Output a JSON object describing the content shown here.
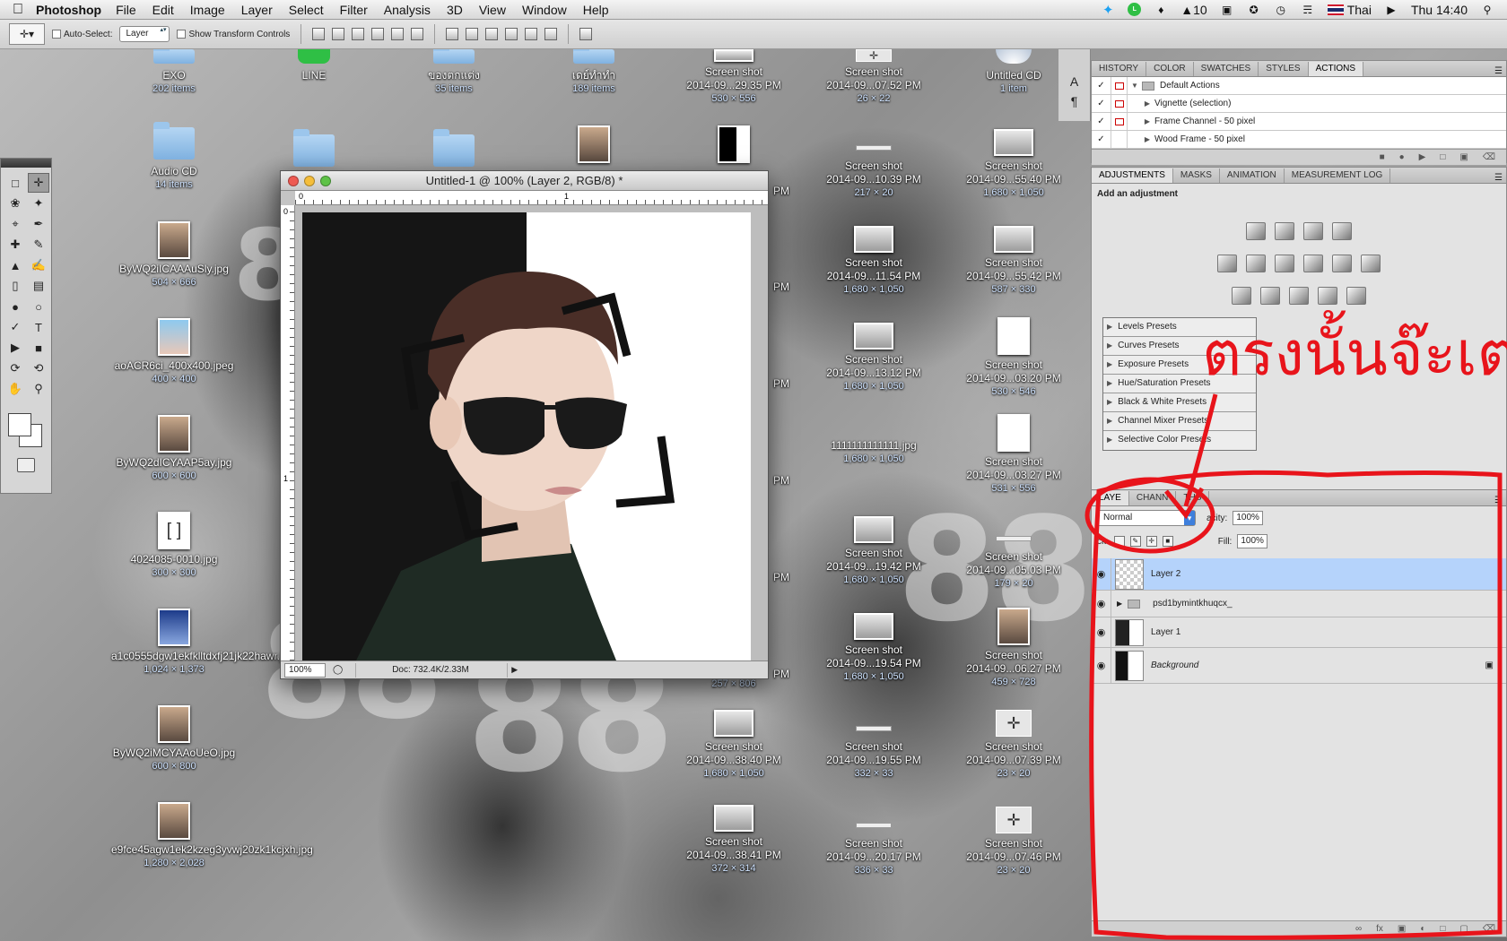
{
  "menubar": {
    "app_name": "Photoshop",
    "items": [
      "File",
      "Edit",
      "Image",
      "Layer",
      "Select",
      "Filter",
      "Analysis",
      "3D",
      "View",
      "Window",
      "Help"
    ],
    "right": {
      "badge": "10",
      "input_source": "Thai",
      "clock": "Thu 14:40"
    }
  },
  "options_bar": {
    "auto_select_label": "Auto-Select:",
    "auto_select_value": "Layer",
    "transform_label": "Show Transform Controls"
  },
  "desktop_icons": [
    {
      "name": "EXO",
      "sub": "202 items"
    },
    {
      "name": "LINE",
      "sub": ""
    },
    {
      "name": "ของตกแต่ง",
      "sub": "35 items"
    },
    {
      "name": "เดย์ทำทำ",
      "sub": "189 items"
    },
    {
      "name": "Screen shot",
      "sub2": "2014-09...29.35 PM",
      "sub": "530 × 556"
    },
    {
      "name": "Screen shot",
      "sub2": "2014-09...07.52 PM",
      "sub": "26 × 22"
    },
    {
      "name": "Untitled CD",
      "sub": "1 item"
    },
    {
      "name": "Audio CD",
      "sub": "14 items"
    },
    {
      "name": "ByWQ2iICAAAuSly.jpg",
      "sub": "504 × 666"
    },
    {
      "name": "aoACR6ci_400x400.jpeg",
      "sub": "400 × 400"
    },
    {
      "name": "ByWQ2dICYAAP5ay.jpg",
      "sub": "600 × 600"
    },
    {
      "name": "4024085-0010.jpg",
      "sub": "300 × 300"
    },
    {
      "name": "a1c0555dgw1ekfklltdxfj21jk22hawr.jpg",
      "sub": "1,024 × 1,373"
    },
    {
      "name": "ByWQ2iMCYAAoUeO.jpg",
      "sub": "600 × 800"
    },
    {
      "name": "e9fce45agw1ek2kzeg3yvwj20zk1kcjxh.jpg",
      "sub": "1,280 × 2,028"
    },
    {
      "name": "Screen shot",
      "sub2": "2014-09...10.39 PM",
      "sub": "217 × 20"
    },
    {
      "name": "Screen shot",
      "sub2": "2014-09...55.40 PM",
      "sub": "1,680 × 1,050"
    },
    {
      "name": "Screen shot",
      "sub2": "2014-09...11.54 PM",
      "sub": "1,680 × 1,050"
    },
    {
      "name": "Screen shot",
      "sub2": "2014-09...55.42 PM",
      "sub": "587 × 330"
    },
    {
      "name": "Screen shot",
      "sub2": "2014-09...13.12 PM",
      "sub": "1,680 × 1,050"
    },
    {
      "name": "Screen shot",
      "sub2": "2014-09...03.20 PM",
      "sub": "530 × 546"
    },
    {
      "name": "1111111111111.jpg",
      "sub": "1,680 × 1,050"
    },
    {
      "name": "Screen shot",
      "sub2": "2014-09...03.27 PM",
      "sub": "531 × 556"
    },
    {
      "name": "Screen shot",
      "sub2": "2014-09...19.42 PM",
      "sub": "1,680 × 1,050"
    },
    {
      "name": "Screen shot",
      "sub2": "2014-09...05.03 PM",
      "sub": "179 × 20"
    },
    {
      "name": "Screen shot",
      "sub2": "2014-09...19.54 PM",
      "sub": "1,680 × 1,050"
    },
    {
      "name": "Screen shot",
      "sub2": "2014-09...06.27 PM",
      "sub": "459 × 728"
    },
    {
      "name": "Screen shot",
      "sub2": "2014-09...38.40 PM",
      "sub": "1,680 × 1,050"
    },
    {
      "name": "Screen shot",
      "sub2": "2014-09...19.55 PM",
      "sub": "332 × 33"
    },
    {
      "name": "Screen shot",
      "sub2": "2014-09...07.39 PM",
      "sub": "23 × 20"
    },
    {
      "name": "Screen shot",
      "sub2": "2014-09...38.41 PM",
      "sub": "372 × 314"
    },
    {
      "name": "Screen shot",
      "sub2": "2014-09...20.17 PM",
      "sub": "336 × 33"
    },
    {
      "name": "Screen shot",
      "sub2": "2014-09...07.46 PM",
      "sub": "23 × 20"
    },
    {
      "name": "",
      "sub": "257 × 806"
    }
  ],
  "partial_labels": [
    "PM",
    "PM",
    "PM",
    "PM",
    "PM",
    "PM",
    "PM"
  ],
  "document": {
    "title": "Untitled-1 @ 100% (Layer 2, RGB/8) *",
    "ruler_h": [
      "0",
      "1"
    ],
    "ruler_v": [
      "0",
      "1"
    ],
    "zoom": "100%",
    "doc_info": "Doc: 732.4K/2.33M"
  },
  "actions_panel": {
    "tabs": [
      "HISTORY",
      "COLOR",
      "SWATCHES",
      "STYLES",
      "ACTIONS"
    ],
    "active_tab": "ACTIONS",
    "rows": [
      "Default Actions",
      "Vignette (selection)",
      "Frame Channel - 50 pixel",
      "Wood Frame - 50 pixel"
    ]
  },
  "adjustments_panel": {
    "tabs": [
      "ADJUSTMENTS",
      "MASKS",
      "ANIMATION",
      "MEASUREMENT LOG"
    ],
    "active_tab": "ADJUSTMENTS",
    "heading": "Add an adjustment",
    "presets": [
      "Levels Presets",
      "Curves Presets",
      "Exposure Presets",
      "Hue/Saturation Presets",
      "Black & White Presets",
      "Channel Mixer Presets",
      "Selective Color Presets"
    ]
  },
  "layers_panel": {
    "tabs": [
      "LAYERS",
      "CHANNELS",
      "PATHS"
    ],
    "tab_visible": [
      "LAYE",
      "CHANN",
      "THS"
    ],
    "blend_mode": "Normal",
    "opacity_label": "Opacity:",
    "opacity_label_visible": "acity:",
    "opacity": "100%",
    "lock_label": "Lock:",
    "lock_label_visible": "ck:",
    "fill_label": "Fill:",
    "fill": "100%",
    "layers": [
      "Layer 2",
      "psd1bymintkhuqcx_",
      "Layer 1",
      "Background"
    ],
    "selected_layer": "Layer 2"
  },
  "annotation": {
    "text": "ตรงนั้นจ๊ะเตง",
    "color": "#e8141b"
  },
  "colors": {
    "selection": "#b5d3fb",
    "annotation": "#e8141b",
    "accent": "#3e7fdc"
  }
}
